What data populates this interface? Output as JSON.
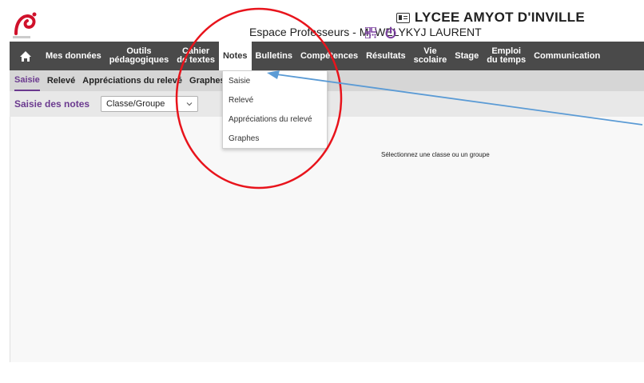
{
  "header": {
    "logo_alt": "Amyot d'Inville",
    "school_name": "LYCEE AMYOT D'INVILLE",
    "space_label": "Espace Professeurs - M. WELYKYJ LAURENT"
  },
  "topnav": {
    "items": [
      {
        "line1": "",
        "line2": "Mes données"
      },
      {
        "line1": "Outils",
        "line2": "pédagogiques"
      },
      {
        "line1": "Cahier",
        "line2": "de textes"
      },
      {
        "line1": "",
        "line2": "Notes"
      },
      {
        "line1": "",
        "line2": "Bulletins"
      },
      {
        "line1": "",
        "line2": "Compétences"
      },
      {
        "line1": "",
        "line2": "Résultats"
      },
      {
        "line1": "Vie",
        "line2": "scolaire"
      },
      {
        "line1": "",
        "line2": "Stage"
      },
      {
        "line1": "Emploi",
        "line2": "du temps"
      },
      {
        "line1": "",
        "line2": "Communication"
      }
    ]
  },
  "subnav": {
    "items": [
      "Saisie",
      "Relevé",
      "Appréciations du relevé",
      "Graphes"
    ]
  },
  "toolbar": {
    "title": "Saisie des notes",
    "select_value": "Classe/Groupe"
  },
  "main": {
    "empty_message": "Sélectionnez une classe ou un groupe"
  },
  "dropdown": {
    "items": [
      "Saisie",
      "Relevé",
      "Appréciations du relevé",
      "Graphes"
    ]
  },
  "colors": {
    "nav_bg": "#4a4a4a",
    "accent_purple": "#6b3a8f",
    "logo_red": "#d0112b",
    "annotation_red": "#e8141c",
    "annotation_blue": "#5b9bd5"
  },
  "icons": [
    "home-icon",
    "id-card-icon",
    "qr-code-icon",
    "power-icon",
    "chevron-down-icon"
  ]
}
